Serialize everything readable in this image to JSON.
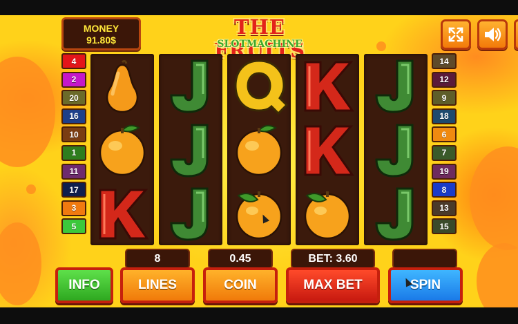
{
  "header": {
    "money_label": "MONEY",
    "money_value": "91.80$",
    "title": "THE FRUITS",
    "subtitle": "SLOTMACHINE",
    "fullscreen_icon": "fullscreen-icon",
    "sound_icon": "speaker-icon"
  },
  "paylines": {
    "left": [
      {
        "label": "4",
        "color": "#e3151a"
      },
      {
        "label": "2",
        "color": "#c418c9"
      },
      {
        "label": "20",
        "color": "#6b6b2a"
      },
      {
        "label": "16",
        "color": "#1d3f8a"
      },
      {
        "label": "10",
        "color": "#7a3d12"
      },
      {
        "label": "1",
        "color": "#2e7d1e"
      },
      {
        "label": "11",
        "color": "#6e2b6e"
      },
      {
        "label": "17",
        "color": "#0f1f4d"
      },
      {
        "label": "3",
        "color": "#f07a10"
      },
      {
        "label": "5",
        "color": "#3cc83c"
      }
    ],
    "right": [
      {
        "label": "14",
        "color": "#5e4a2a"
      },
      {
        "label": "12",
        "color": "#5a1a3a"
      },
      {
        "label": "9",
        "color": "#5e5e2a"
      },
      {
        "label": "18",
        "color": "#1d4a6e"
      },
      {
        "label": "6",
        "color": "#f08a10"
      },
      {
        "label": "7",
        "color": "#3a5a2a"
      },
      {
        "label": "19",
        "color": "#6e2b5e"
      },
      {
        "label": "8",
        "color": "#1a3cc8"
      },
      {
        "label": "13",
        "color": "#4a3a2a"
      },
      {
        "label": "15",
        "color": "#3a4a2a"
      }
    ]
  },
  "reels": [
    [
      "pear",
      "orange",
      "K"
    ],
    [
      "J",
      "J",
      "J"
    ],
    [
      "Q",
      "orange",
      "peach"
    ],
    [
      "K",
      "K",
      "peach"
    ],
    [
      "J",
      "J",
      "J"
    ]
  ],
  "controls": {
    "lines_value": "8",
    "coin_value": "0.45",
    "bet_value": "BET: 3.60",
    "win_value": "",
    "info_label": "INFO",
    "lines_label": "LINES",
    "coin_label": "COIN",
    "maxbet_label": "MAX BET",
    "spin_label": "SPIN"
  },
  "colors": {
    "background": "#ffd21a",
    "accent_orange": "#f07a0a",
    "reel_bg": "#3b1a0c",
    "title_red": "#e2231a",
    "subtitle_green": "#3ea82c"
  }
}
